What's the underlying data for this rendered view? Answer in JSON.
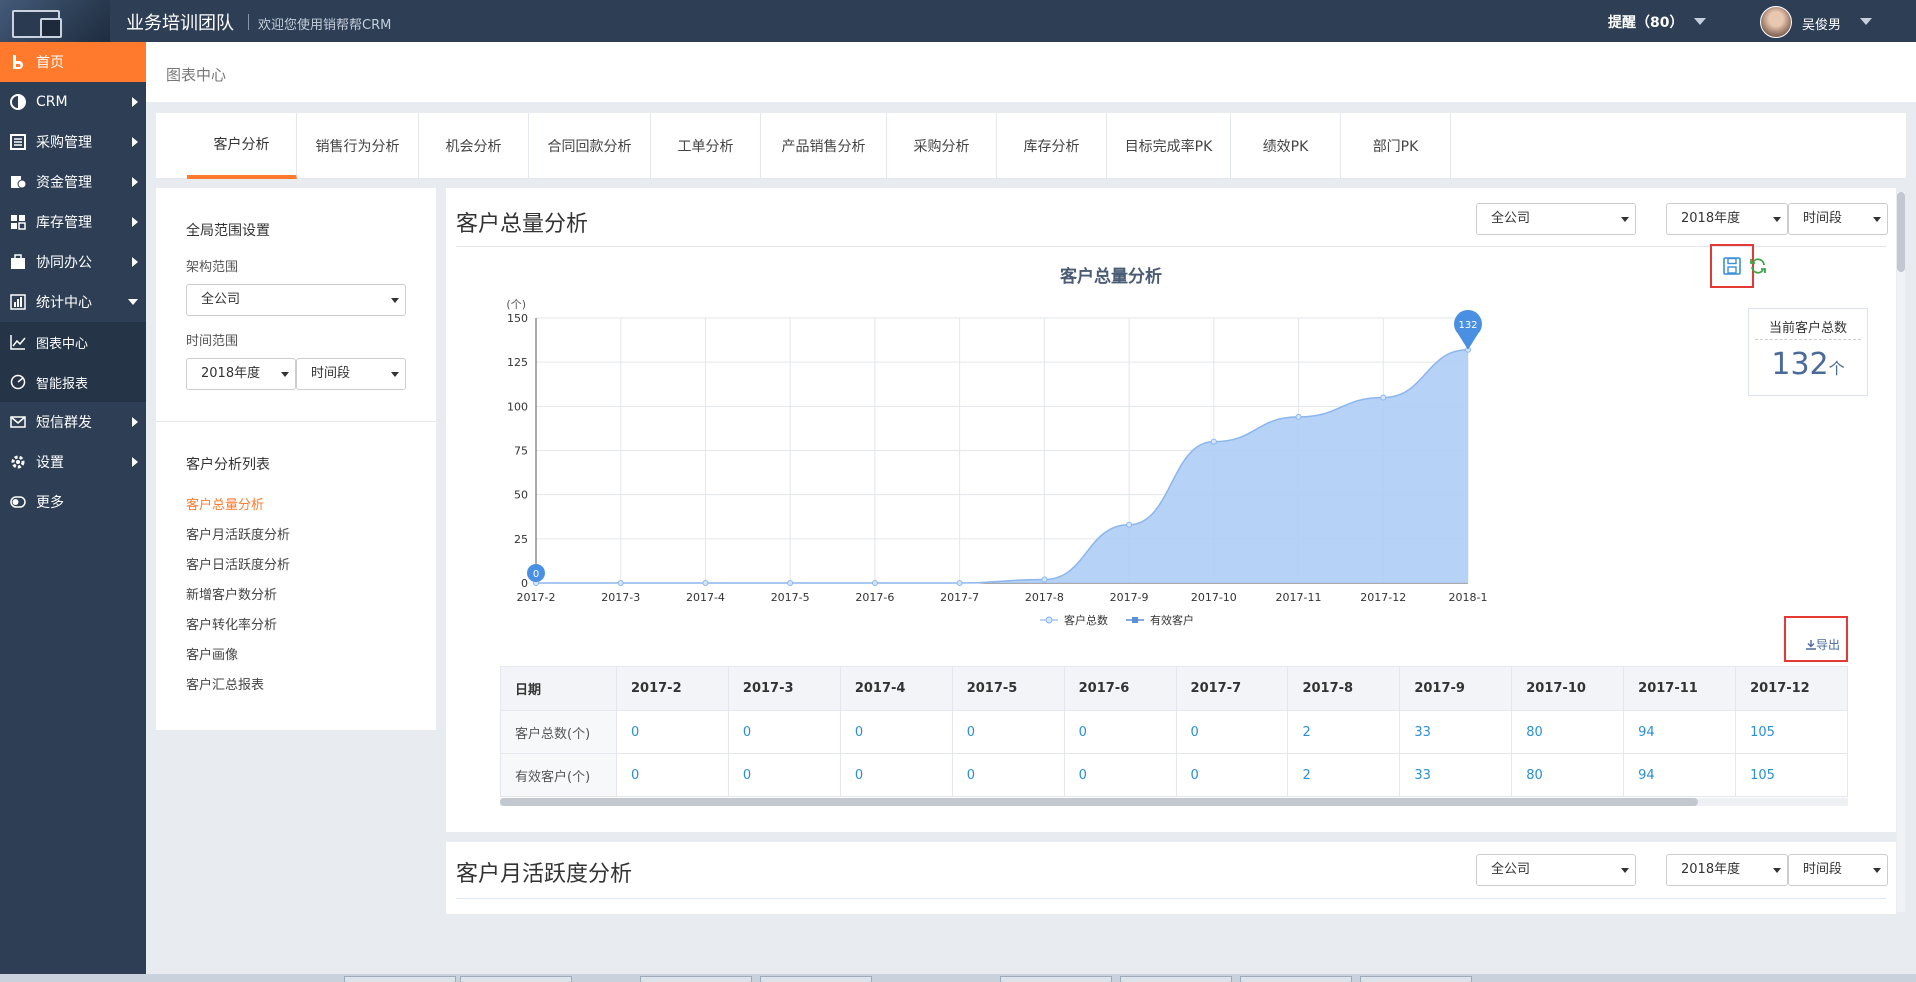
{
  "topbar": {
    "team_name": "业务培训团队",
    "welcome": "欢迎您使用销帮帮CRM",
    "reminder": "提醒（80）",
    "username": "吴俊男"
  },
  "sidebar": {
    "items": [
      {
        "label": "首页",
        "icon": "home-icon"
      },
      {
        "label": "CRM",
        "icon": "crm-pie-icon"
      },
      {
        "label": "采购管理",
        "icon": "purchase-icon"
      },
      {
        "label": "资金管理",
        "icon": "fund-icon"
      },
      {
        "label": "库存管理",
        "icon": "inventory-icon"
      },
      {
        "label": "协同办公",
        "icon": "briefcase-icon"
      },
      {
        "label": "统计中心",
        "icon": "bar-chart-icon"
      },
      {
        "label": "图表中心",
        "icon": "line-chart-icon"
      },
      {
        "label": "智能报表",
        "icon": "report-icon"
      },
      {
        "label": "短信群发",
        "icon": "sms-icon"
      },
      {
        "label": "设置",
        "icon": "gear-icon"
      },
      {
        "label": "更多",
        "icon": "toggle-icon"
      }
    ]
  },
  "page_title": "图表中心",
  "tabs": [
    "客户分析",
    "销售行为分析",
    "机会分析",
    "合同回款分析",
    "工单分析",
    "产品销售分析",
    "采购分析",
    "库存分析",
    "目标完成率PK",
    "绩效PK",
    "部门PK"
  ],
  "left_panel": {
    "scope_title": "全局范围设置",
    "org_label": "架构范围",
    "org_value": "全公司",
    "time_label": "时间范围",
    "year_value": "2018年度",
    "period_value": "时间段",
    "list_title": "客户分析列表",
    "links": [
      "客户总量分析",
      "客户月活跃度分析",
      "客户日活跃度分析",
      "新增客户数分析",
      "客户转化率分析",
      "客户画像",
      "客户汇总报表"
    ]
  },
  "main_card": {
    "title": "客户总量分析",
    "company_select": "全公司",
    "year_select": "2018年度",
    "period_select": "时间段",
    "kpi_label": "当前客户总数",
    "kpi_value": "132",
    "kpi_unit": "个",
    "export_label": "导出"
  },
  "chart_data": {
    "type": "area",
    "title": "客户总量分析",
    "ylabel": "(个)",
    "x": [
      "2017-2",
      "2017-3",
      "2017-4",
      "2017-5",
      "2017-6",
      "2017-7",
      "2017-8",
      "2017-9",
      "2017-10",
      "2017-11",
      "2017-12",
      "2018-1"
    ],
    "ylim": [
      0,
      150
    ],
    "yticks": [
      0,
      25,
      50,
      75,
      100,
      125,
      150
    ],
    "series": [
      {
        "name": "客户总数",
        "values": [
          0,
          0,
          0,
          0,
          0,
          0,
          2,
          33,
          80,
          94,
          105,
          132
        ],
        "color": "#aecdf5"
      },
      {
        "name": "有效客户",
        "values": [
          0,
          0,
          0,
          0,
          0,
          0,
          2,
          33,
          80,
          94,
          105,
          132
        ],
        "color": "#5b8fd6"
      }
    ],
    "markers": {
      "min_label": "0",
      "max_label": "132"
    },
    "grid": true,
    "legend": "bottom-center"
  },
  "table": {
    "header_label": "日期",
    "columns": [
      "2017-2",
      "2017-3",
      "2017-4",
      "2017-5",
      "2017-6",
      "2017-7",
      "2017-8",
      "2017-9",
      "2017-10",
      "2017-11",
      "2017-12"
    ],
    "rows": [
      {
        "label": "客户总数(个)",
        "values": [
          "0",
          "0",
          "0",
          "0",
          "0",
          "0",
          "2",
          "33",
          "80",
          "94",
          "105"
        ]
      },
      {
        "label": "有效客户(个)",
        "values": [
          "0",
          "0",
          "0",
          "0",
          "0",
          "0",
          "2",
          "33",
          "80",
          "94",
          "105"
        ]
      }
    ]
  },
  "second_card": {
    "title": "客户月活跃度分析",
    "company_select": "全公司",
    "year_select": "2018年度",
    "period_select": "时间段"
  },
  "colors": {
    "accent": "#ff7a2d",
    "sidebar_bg": "#2d3e55",
    "chart_fill": "#aecdf5",
    "link_blue": "#2a8fd6",
    "highlight_red": "#e53935"
  }
}
